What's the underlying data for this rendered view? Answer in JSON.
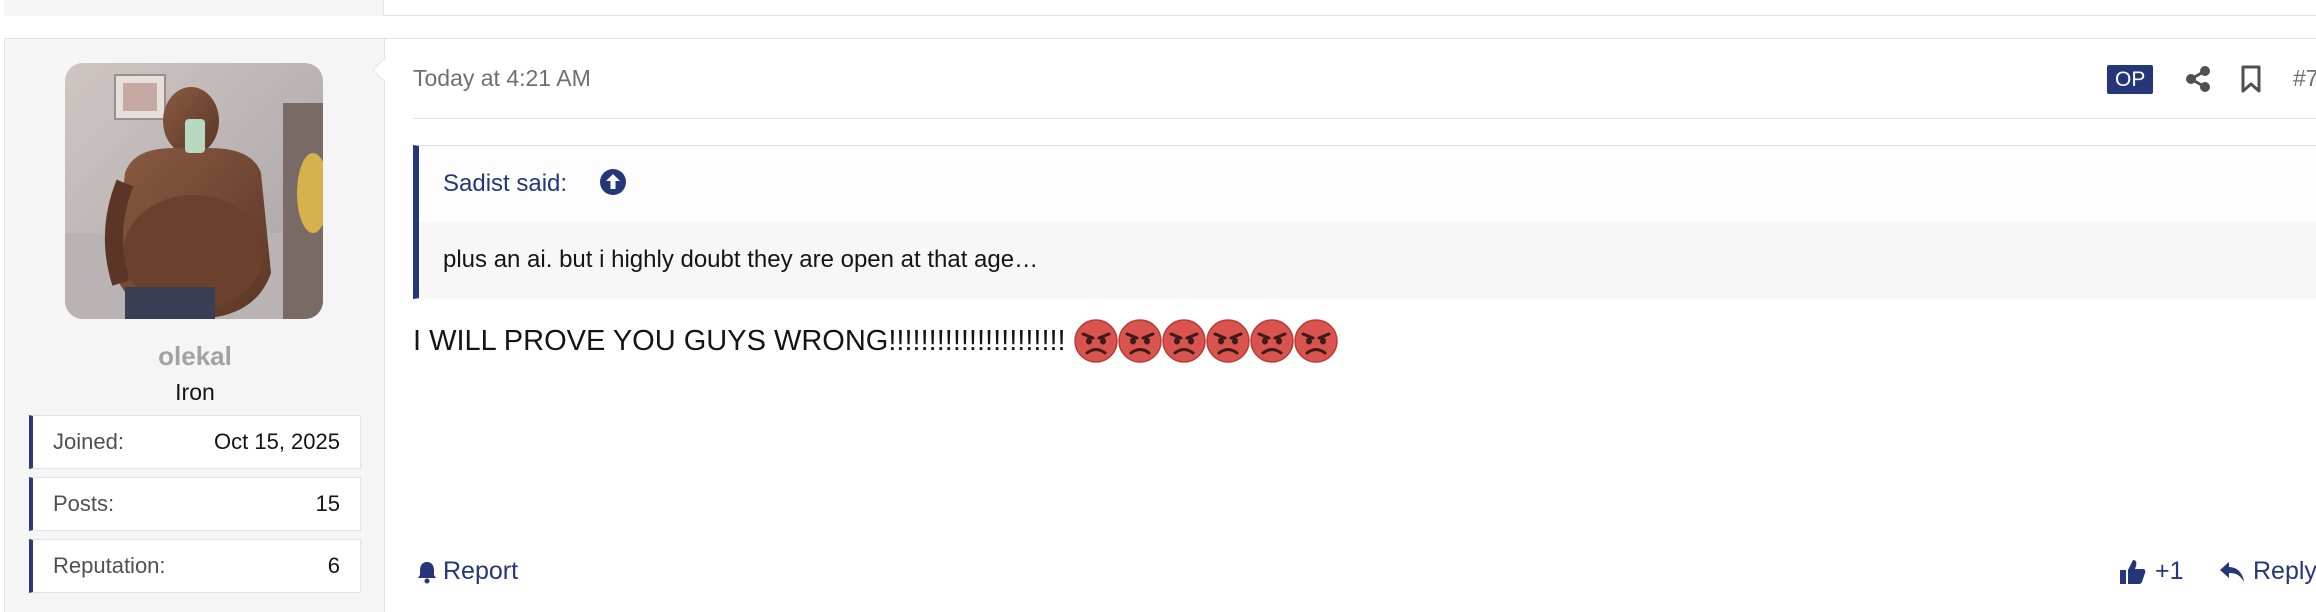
{
  "post": {
    "user": {
      "username": "olekal",
      "title": "Iron",
      "stats": [
        {
          "label": "Joined:",
          "value": "Oct 15, 2025"
        },
        {
          "label": "Posts:",
          "value": "15"
        },
        {
          "label": "Reputation:",
          "value": "6"
        }
      ]
    },
    "attribution": {
      "date": "Today at 4:21 AM",
      "op_badge": "OP",
      "post_number": "#7"
    },
    "quote": {
      "author": "Sadist said:",
      "text": "plus an ai. but i highly doubt they are open at that age…"
    },
    "message": {
      "text": "I WILL PROVE YOU GUYS WRONG!!!!!!!!!!!!!!!!!!!!!!",
      "emoji_icon": "angry-face-emoji",
      "emoji_count": 6
    },
    "actions": {
      "report": "Report",
      "like": "+1",
      "reply": "Reply"
    }
  },
  "colors": {
    "accent": "#253679",
    "sidebar_bg": "#f5f5f5",
    "border": "#e2e3e5",
    "muted_text": "#6f6f6f",
    "username_text": "#a3a3a3"
  }
}
